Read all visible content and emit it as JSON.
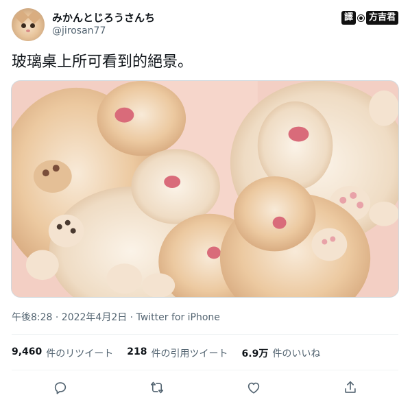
{
  "user": {
    "display_name": "みかんとじろうさんち",
    "handle": "@jirosan77",
    "avatar_icon": "cat-avatar-icon"
  },
  "watermark": {
    "part1": "譯",
    "part2": "方吉君"
  },
  "tweet": {
    "text": "玻璃桌上所可看到的絕景。",
    "image_alt": "cats-under-glass-table-photo"
  },
  "meta": {
    "timestamp": "午後8:28 · 2022年4月2日 · Twitter for iPhone"
  },
  "stats": {
    "retweets_value": "9,460",
    "retweets_label": "件のリツイート",
    "quotes_value": "218",
    "quotes_label": "件の引用ツイート",
    "likes_value": "6.9万",
    "likes_label": "件のいいね"
  },
  "actions": {
    "icons": [
      "reply-icon",
      "retweet-icon",
      "like-icon",
      "share-icon"
    ]
  },
  "colors": {
    "text_primary": "#0f1419",
    "text_secondary": "#536471",
    "divider": "#eff3f4",
    "media_background": "#f2cbc2"
  }
}
